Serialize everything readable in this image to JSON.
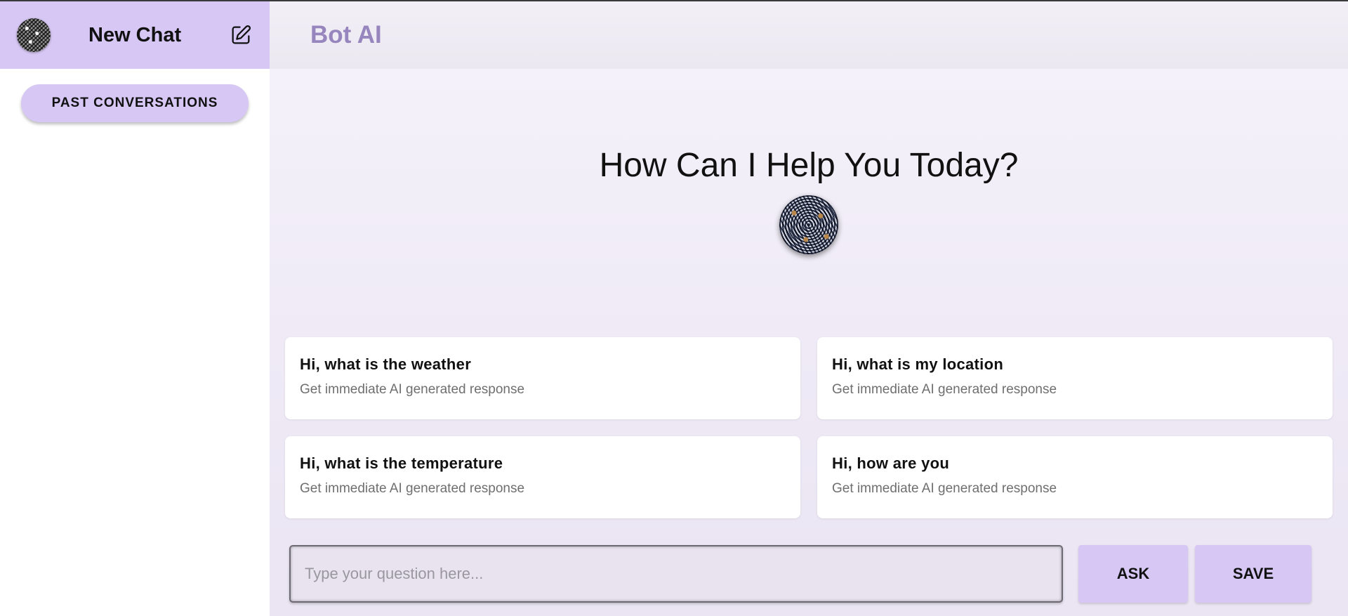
{
  "sidebar": {
    "new_chat_label": "New Chat",
    "past_conversations_label": "PAST CONVERSATIONS"
  },
  "header": {
    "brand": "Bot AI"
  },
  "hero": {
    "title": "How Can I Help You Today?"
  },
  "suggestions": [
    {
      "title": "Hi, what is the weather",
      "subtitle": "Get immediate AI generated response"
    },
    {
      "title": "Hi, what is my location",
      "subtitle": "Get immediate AI generated response"
    },
    {
      "title": "Hi, what is the temperature",
      "subtitle": "Get immediate AI generated response"
    },
    {
      "title": "Hi, how are you",
      "subtitle": "Get immediate AI generated response"
    }
  ],
  "composer": {
    "placeholder": "Type your question here...",
    "value": "",
    "ask_label": "ASK",
    "save_label": "SAVE"
  },
  "colors": {
    "accent": "#d7c7f4",
    "brand_text": "#9785bd"
  },
  "icons": {
    "edit": "edit-pencil-icon"
  }
}
